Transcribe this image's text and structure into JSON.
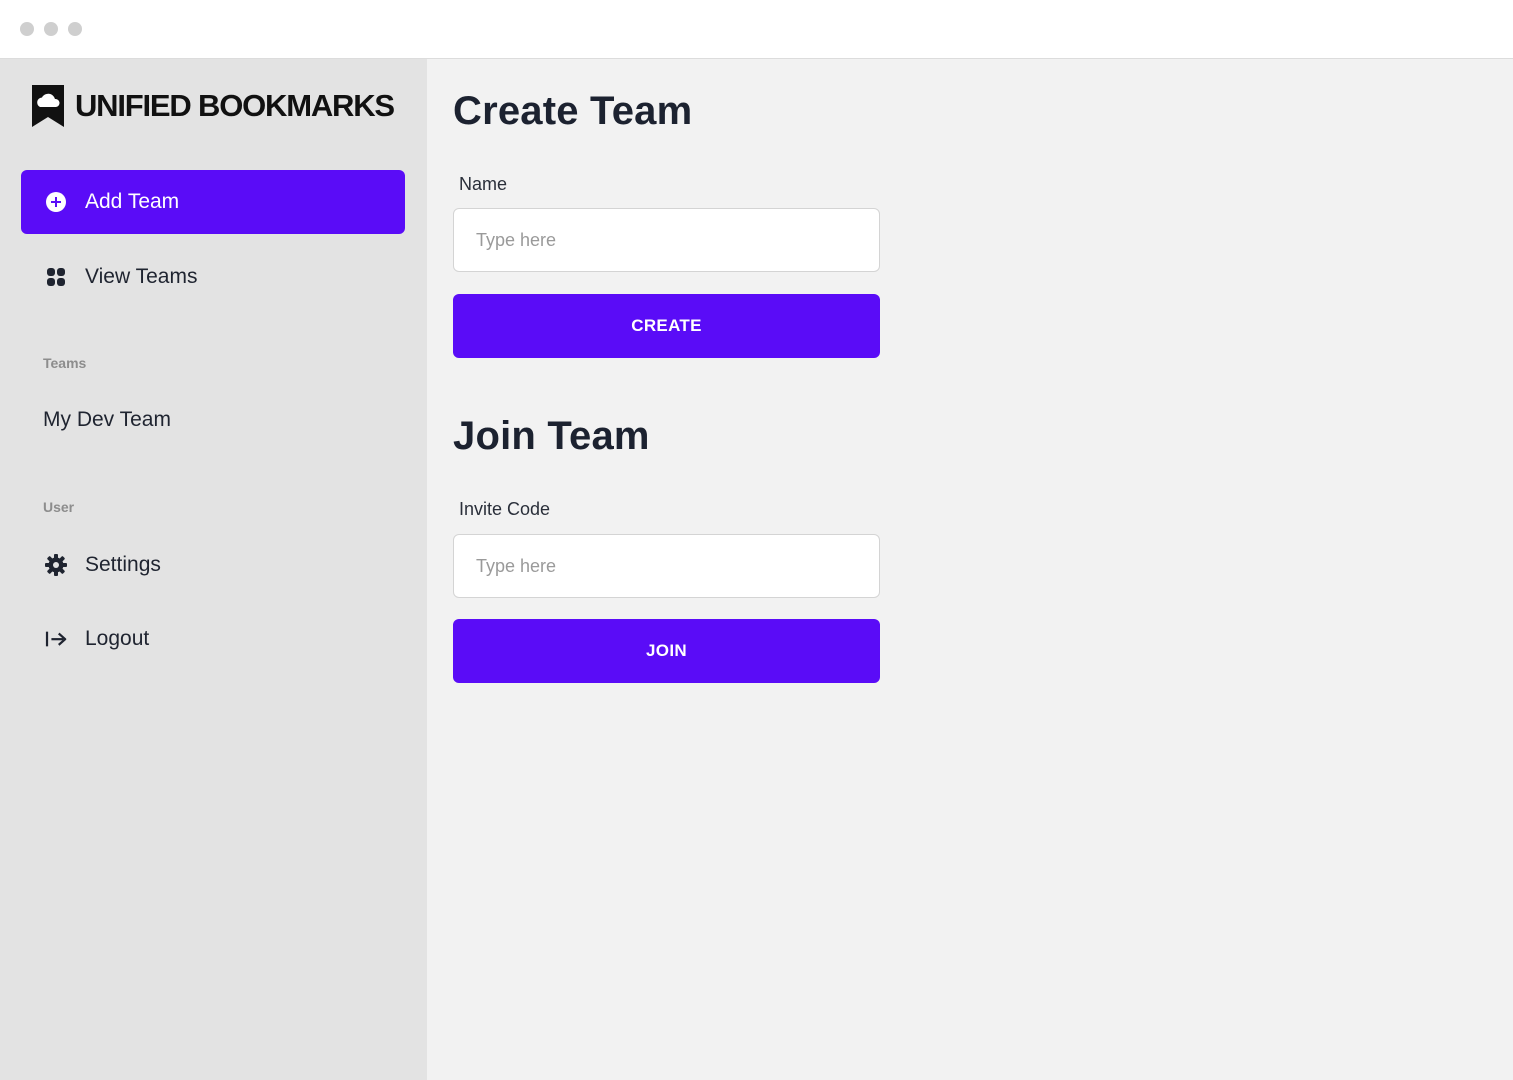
{
  "app": {
    "logo_text": "UNIFIED BOOKMARKS",
    "logo_icon": "bookmark-cloud-icon",
    "accent_color": "#5a0cf7"
  },
  "sidebar": {
    "nav": [
      {
        "label": "Add Team",
        "icon": "plus-circle-icon",
        "active": true
      },
      {
        "label": "View Teams",
        "icon": "grid-icon",
        "active": false
      }
    ],
    "teams_section_label": "Teams",
    "teams": [
      {
        "label": "My Dev Team"
      }
    ],
    "user_section_label": "User",
    "user_items": [
      {
        "label": "Settings",
        "icon": "gear-icon"
      },
      {
        "label": "Logout",
        "icon": "logout-icon"
      }
    ]
  },
  "create_team": {
    "title": "Create Team",
    "name_label": "Name",
    "name_value": "",
    "name_placeholder": "Type here",
    "button_label": "CREATE"
  },
  "join_team": {
    "title": "Join Team",
    "code_label": "Invite Code",
    "code_value": "",
    "code_placeholder": "Type here",
    "button_label": "JOIN"
  }
}
